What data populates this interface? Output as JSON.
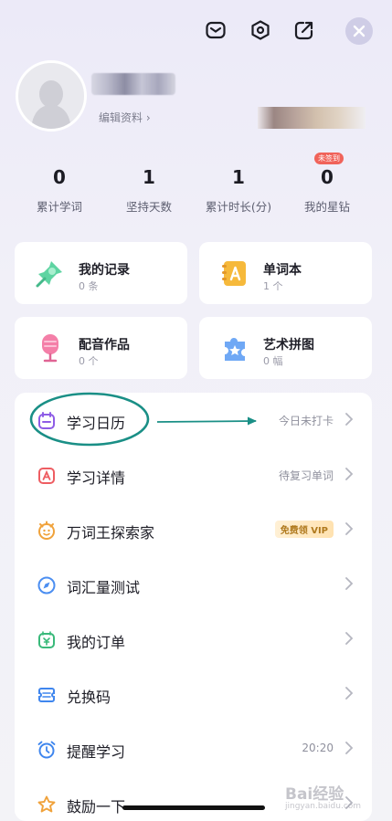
{
  "header": {
    "icons": [
      "mail-icon",
      "settings-icon",
      "share-icon",
      "close-icon"
    ]
  },
  "profile": {
    "edit_link": "编辑资料 ›"
  },
  "stats": [
    {
      "value": "0",
      "label": "累计学词"
    },
    {
      "value": "1",
      "label": "坚持天数"
    },
    {
      "value": "1",
      "label": "累计时长(分)"
    },
    {
      "value": "0",
      "label": "我的星钻",
      "badge": "未签到"
    }
  ],
  "cards": [
    {
      "title": "我的记录",
      "sub": "0 条",
      "icon": "pin-icon"
    },
    {
      "title": "单词本",
      "sub": "1 个",
      "icon": "wordbook-icon"
    },
    {
      "title": "配音作品",
      "sub": "0 个",
      "icon": "microphone-icon"
    },
    {
      "title": "艺术拼图",
      "sub": "0 幅",
      "icon": "puzzle-icon"
    }
  ],
  "menu": [
    {
      "label": "学习日历",
      "right": "今日未打卡",
      "icon": "calendar-icon"
    },
    {
      "label": "学习详情",
      "right": "待复习单词",
      "icon": "detail-icon"
    },
    {
      "label": "万词王探索家",
      "right": "免费领 VIP",
      "icon": "explorer-icon"
    },
    {
      "label": "词汇量测试",
      "right": "",
      "icon": "compass-icon"
    },
    {
      "label": "我的订单",
      "right": "",
      "icon": "order-icon"
    },
    {
      "label": "兑换码",
      "right": "",
      "icon": "ticket-icon"
    },
    {
      "label": "提醒学习",
      "right": "20:20",
      "icon": "alarm-icon"
    },
    {
      "label": "鼓励一下",
      "right": "",
      "icon": "star-icon"
    }
  ],
  "watermark": {
    "main": "Bai经验",
    "sub": "jingyan.baidu.com"
  },
  "colors": {
    "annotation": "#1a8f86",
    "accent": "#6b63d8"
  }
}
